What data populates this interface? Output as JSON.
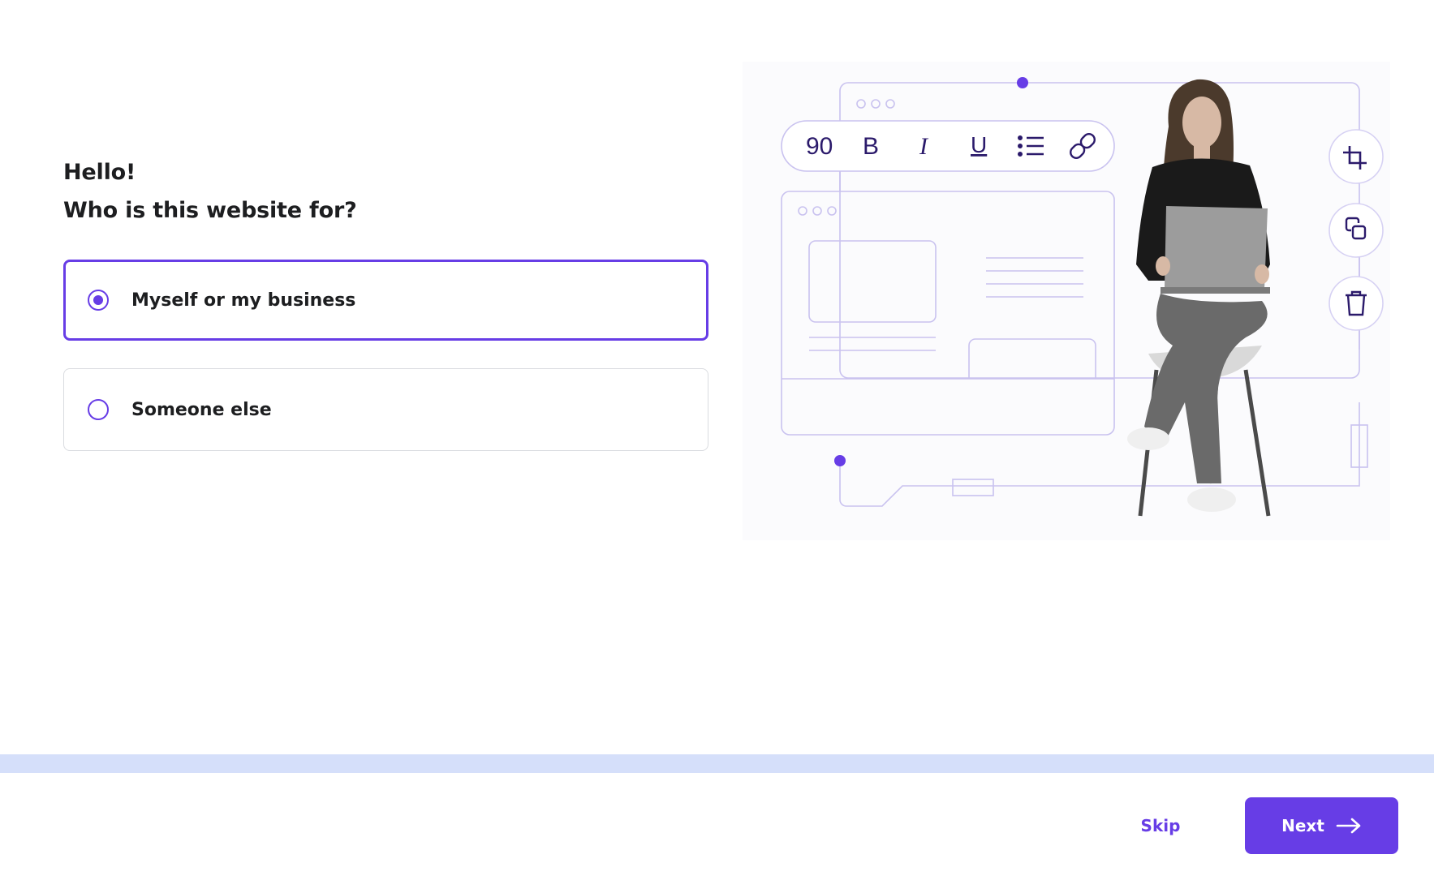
{
  "heading": {
    "greeting": "Hello!",
    "question": "Who is this website for?"
  },
  "options": [
    {
      "label": "Myself or my business",
      "selected": true
    },
    {
      "label": "Someone else",
      "selected": false
    }
  ],
  "illustration": {
    "toolbar": {
      "font_size": "90",
      "bold": "B",
      "italic": "I",
      "underline": "U",
      "icons": [
        "list-icon",
        "link-icon"
      ]
    },
    "side_tools": [
      "crop-icon",
      "copy-icon",
      "trash-icon"
    ],
    "accent_color": "#673de6",
    "line_color": "#c9c2ef"
  },
  "footer": {
    "skip_label": "Skip",
    "next_label": "Next",
    "next_icon": "arrow-right-icon"
  },
  "colors": {
    "primary": "#673de6",
    "progress_track": "#d5dffa",
    "text": "#1d1e20",
    "border": "#dadce0"
  }
}
